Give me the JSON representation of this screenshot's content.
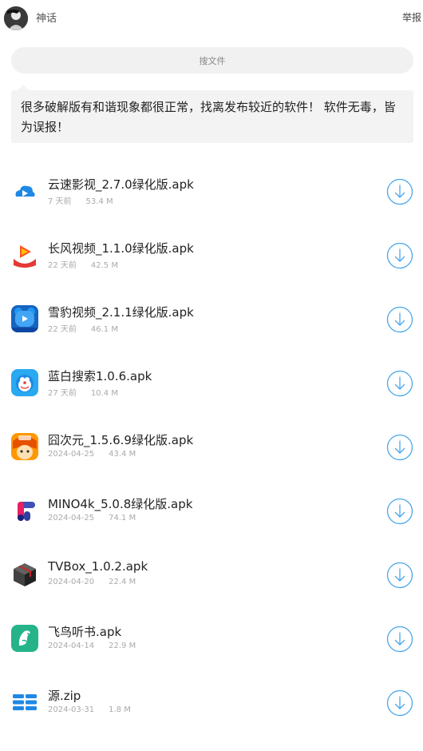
{
  "header": {
    "username": "神话",
    "report_label": "举报"
  },
  "search": {
    "placeholder": "搜文件"
  },
  "notice": {
    "text": "很多破解版有和谐现象都很正常，找离发布较近的软件！ 软件无毒，皆为误报！"
  },
  "colors": {
    "accent": "#4aa7e8",
    "meta_text": "#aaaaaa",
    "notice_bg": "#f3f3f3"
  },
  "files": [
    {
      "name": "云速影视_2.7.0绿化版.apk",
      "date": "7 天前",
      "size": "53.4 M",
      "icon": "cloud-app-icon"
    },
    {
      "name": "长风视频_1.1.0绿化版.apk",
      "date": "22 天前",
      "size": "42.5 M",
      "icon": "play-app-icon"
    },
    {
      "name": "雪豹视频_2.1.1绿化版.apk",
      "date": "22 天前",
      "size": "46.1 M",
      "icon": "bear-app-icon"
    },
    {
      "name": "蓝白搜索1.0.6.apk",
      "date": "27 天前",
      "size": "10.4 M",
      "icon": "doraemon-app-icon"
    },
    {
      "name": "囧次元_1.5.6.9绿化版.apk",
      "date": "2024-04-25",
      "size": "43.4 M",
      "icon": "anime-app-icon"
    },
    {
      "name": "MINO4k_5.0.8绿化版.apk",
      "date": "2024-04-25",
      "size": "74.1 M",
      "icon": "mino-app-icon"
    },
    {
      "name": "TVBox_1.0.2.apk",
      "date": "2024-04-20",
      "size": "22.4 M",
      "icon": "box-app-icon"
    },
    {
      "name": "飞鸟听书.apk",
      "date": "2024-04-14",
      "size": "22.9 M",
      "icon": "bird-app-icon"
    },
    {
      "name": "源.zip",
      "date": "2024-03-31",
      "size": "1.8 M",
      "icon": "zip-file-icon"
    }
  ]
}
